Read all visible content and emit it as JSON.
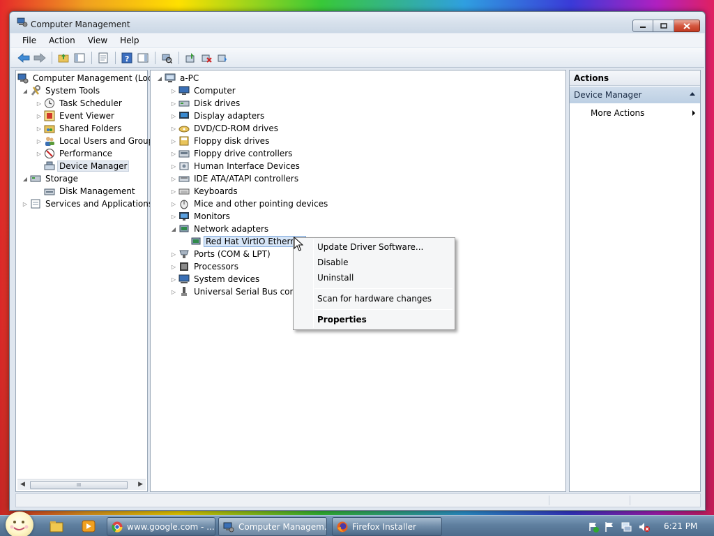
{
  "window": {
    "title": "Computer Management"
  },
  "menu": [
    "File",
    "Action",
    "View",
    "Help"
  ],
  "left_tree": {
    "root": "Computer Management (Local",
    "system_tools": "System Tools",
    "task_scheduler": "Task Scheduler",
    "event_viewer": "Event Viewer",
    "shared_folders": "Shared Folders",
    "local_users": "Local Users and Groups",
    "performance": "Performance",
    "device_manager": "Device Manager",
    "storage": "Storage",
    "disk_management": "Disk Management",
    "services": "Services and Applications",
    "scroll_grip": "III"
  },
  "device_tree": {
    "root": "a-PC",
    "categories": [
      "Computer",
      "Disk drives",
      "Display adapters",
      "DVD/CD-ROM drives",
      "Floppy disk drives",
      "Floppy drive controllers",
      "Human Interface Devices",
      "IDE ATA/ATAPI controllers",
      "Keyboards",
      "Mice and other pointing devices",
      "Monitors",
      "Network adapters",
      "Red Hat VirtIO Ethernet",
      "Ports (COM & LPT)",
      "Processors",
      "System devices",
      "Universal Serial Bus control"
    ]
  },
  "actions": {
    "header": "Actions",
    "group": "Device Manager",
    "more": "More Actions"
  },
  "context_menu": {
    "update": "Update Driver Software...",
    "disable": "Disable",
    "uninstall": "Uninstall",
    "scan": "Scan for hardware changes",
    "properties": "Properties"
  },
  "taskbar": {
    "tasks": [
      "www.google.com - ...",
      "Computer Managem...",
      "Firefox Installer"
    ],
    "clock": "6:21 PM"
  },
  "colors": {
    "selection": "#d6e5f7",
    "actions_group": "#c6d6e8",
    "taskbar": "#5f7f9f"
  }
}
